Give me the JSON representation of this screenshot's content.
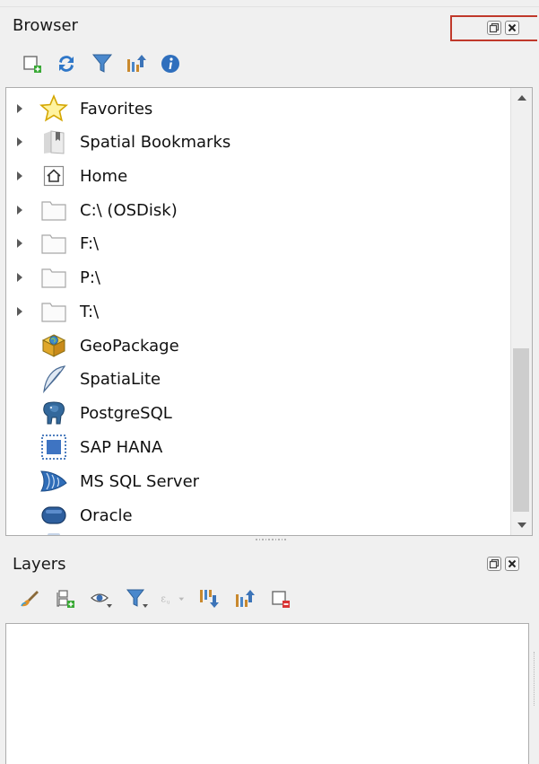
{
  "browser_panel": {
    "title": "Browser",
    "toolbar": [
      {
        "name": "add-selected-layers-icon"
      },
      {
        "name": "refresh-icon"
      },
      {
        "name": "filter-icon"
      },
      {
        "name": "collapse-all-icon"
      },
      {
        "name": "info-icon"
      }
    ],
    "items": [
      {
        "label": "Favorites",
        "icon": "star-icon",
        "expandable": true
      },
      {
        "label": "Spatial Bookmarks",
        "icon": "bookmark-icon",
        "expandable": true
      },
      {
        "label": "Home",
        "icon": "home-icon",
        "expandable": true
      },
      {
        "label": "C:\\ (OSDisk)",
        "icon": "folder-icon",
        "expandable": true
      },
      {
        "label": "F:\\",
        "icon": "folder-icon",
        "expandable": true
      },
      {
        "label": "P:\\",
        "icon": "folder-icon",
        "expandable": true
      },
      {
        "label": "T:\\",
        "icon": "folder-icon",
        "expandable": true
      },
      {
        "label": "GeoPackage",
        "icon": "geopackage-icon",
        "expandable": false
      },
      {
        "label": "SpatiaLite",
        "icon": "feather-icon",
        "expandable": false
      },
      {
        "label": "PostgreSQL",
        "icon": "elephant-icon",
        "expandable": false
      },
      {
        "label": "SAP HANA",
        "icon": "hana-icon",
        "expandable": false
      },
      {
        "label": "MS SQL Server",
        "icon": "mssql-icon",
        "expandable": false
      },
      {
        "label": "Oracle",
        "icon": "oracle-icon",
        "expandable": false
      }
    ]
  },
  "layers_panel": {
    "title": "Layers",
    "toolbar": [
      {
        "name": "open-layer-styling-icon"
      },
      {
        "name": "add-group-icon"
      },
      {
        "name": "manage-visibility-icon"
      },
      {
        "name": "filter-legend-icon"
      },
      {
        "name": "filter-expression-icon"
      },
      {
        "name": "expand-all-icon"
      },
      {
        "name": "collapse-all-icon"
      },
      {
        "name": "remove-layer-icon"
      }
    ]
  },
  "colors": {
    "highlight_box": "#c0392b",
    "panel_bg": "#f0f0f0",
    "tree_bg": "#ffffff"
  }
}
